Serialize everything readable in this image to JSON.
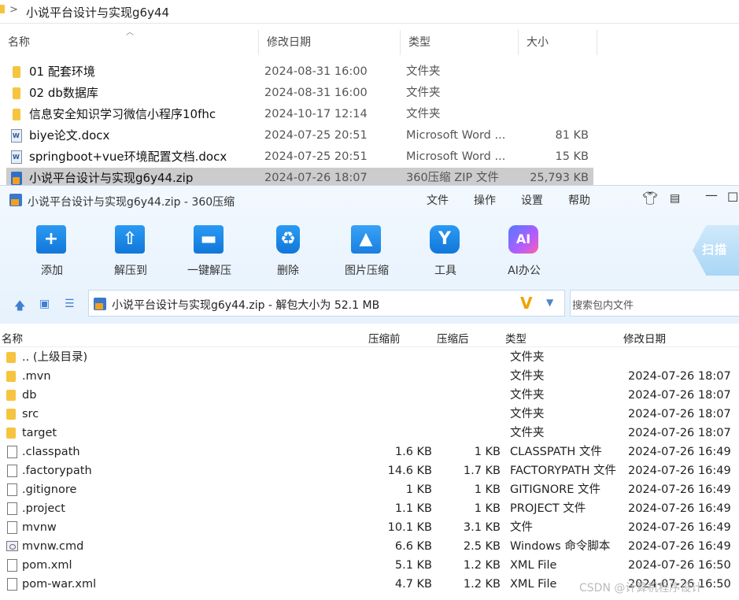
{
  "explorer": {
    "breadcrumb": "小说平台设计与实现g6y44",
    "columns": {
      "name": "名称",
      "date": "修改日期",
      "type": "类型",
      "size": "大小"
    },
    "rows": [
      {
        "icon": "folder-icon",
        "name": "01 配套环境",
        "date": "2024-08-31 16:00",
        "type": "文件夹",
        "size": ""
      },
      {
        "icon": "folder-icon",
        "name": "02 db数据库",
        "date": "2024-08-31 16:00",
        "type": "文件夹",
        "size": ""
      },
      {
        "icon": "folder-icon",
        "name": "信息安全知识学习微信小程序10fhc",
        "date": "2024-10-17 12:14",
        "type": "文件夹",
        "size": ""
      },
      {
        "icon": "word-doc-icon",
        "name": "biye论文.docx",
        "date": "2024-07-25 20:51",
        "type": "Microsoft Word ...",
        "size": "81 KB"
      },
      {
        "icon": "word-doc-icon",
        "name": "springboot+vue环境配置文档.docx",
        "date": "2024-07-25 20:51",
        "type": "Microsoft Word ...",
        "size": "15 KB"
      },
      {
        "icon": "zip-archive-icon",
        "name": "小说平台设计与实现g6y44.zip",
        "date": "2024-07-26 18:07",
        "type": "360压缩 ZIP 文件",
        "size": "25,793 KB",
        "selected": true
      }
    ]
  },
  "zip": {
    "title": "小说平台设计与实现g6y44.zip - 360压缩",
    "menu": [
      "文件",
      "操作",
      "设置",
      "帮助"
    ],
    "toolbar": [
      {
        "label": "添加",
        "icon": "add-icon"
      },
      {
        "label": "解压到",
        "icon": "extract-to-icon"
      },
      {
        "label": "一键解压",
        "icon": "one-click-extract-icon"
      },
      {
        "label": "删除",
        "icon": "delete-icon"
      },
      {
        "label": "图片压缩",
        "icon": "image-compress-icon"
      },
      {
        "label": "工具",
        "icon": "tools-icon"
      },
      {
        "label": "AI办公",
        "icon": "ai-office-icon"
      }
    ],
    "scan_label": "扫描",
    "path_text": "小说平台设计与实现g6y44.zip - 解包大小为 52.1 MB",
    "search_placeholder": "搜索包内文件",
    "columns": {
      "name": "名称",
      "before": "压缩前",
      "after": "压缩后",
      "type": "类型",
      "date": "修改日期"
    },
    "rows": [
      {
        "icon": "folder-icon",
        "name": ".. (上级目录)",
        "before": "",
        "after": "",
        "type": "文件夹",
        "date": ""
      },
      {
        "icon": "folder-icon",
        "name": ".mvn",
        "before": "",
        "after": "",
        "type": "文件夹",
        "date": "2024-07-26 18:07"
      },
      {
        "icon": "folder-icon",
        "name": "db",
        "before": "",
        "after": "",
        "type": "文件夹",
        "date": "2024-07-26 18:07"
      },
      {
        "icon": "folder-icon",
        "name": "src",
        "before": "",
        "after": "",
        "type": "文件夹",
        "date": "2024-07-26 18:07"
      },
      {
        "icon": "folder-icon",
        "name": "target",
        "before": "",
        "after": "",
        "type": "文件夹",
        "date": "2024-07-26 18:07"
      },
      {
        "icon": "file-icon",
        "name": ".classpath",
        "before": "1.6 KB",
        "after": "1 KB",
        "type": "CLASSPATH 文件",
        "date": "2024-07-26 16:49"
      },
      {
        "icon": "file-icon",
        "name": ".factorypath",
        "before": "14.6 KB",
        "after": "1.7 KB",
        "type": "FACTORYPATH 文件",
        "date": "2024-07-26 16:49"
      },
      {
        "icon": "file-icon",
        "name": ".gitignore",
        "before": "1 KB",
        "after": "1 KB",
        "type": "GITIGNORE 文件",
        "date": "2024-07-26 16:49"
      },
      {
        "icon": "file-icon",
        "name": ".project",
        "before": "1.1 KB",
        "after": "1 KB",
        "type": "PROJECT 文件",
        "date": "2024-07-26 16:49"
      },
      {
        "icon": "file-icon",
        "name": "mvnw",
        "before": "10.1 KB",
        "after": "3.1 KB",
        "type": "文件",
        "date": "2024-07-26 16:49"
      },
      {
        "icon": "cmd-script-icon",
        "name": "mvnw.cmd",
        "before": "6.6 KB",
        "after": "2.5 KB",
        "type": "Windows 命令脚本",
        "date": "2024-07-26 16:49"
      },
      {
        "icon": "file-icon",
        "name": "pom.xml",
        "before": "5.1 KB",
        "after": "1.2 KB",
        "type": "XML File",
        "date": "2024-07-26 16:50"
      },
      {
        "icon": "file-icon",
        "name": "pom-war.xml",
        "before": "4.7 KB",
        "after": "1.2 KB",
        "type": "XML File",
        "date": "2024-07-26 16:50"
      }
    ]
  },
  "watermark": "CSDN @计算机程序设计"
}
